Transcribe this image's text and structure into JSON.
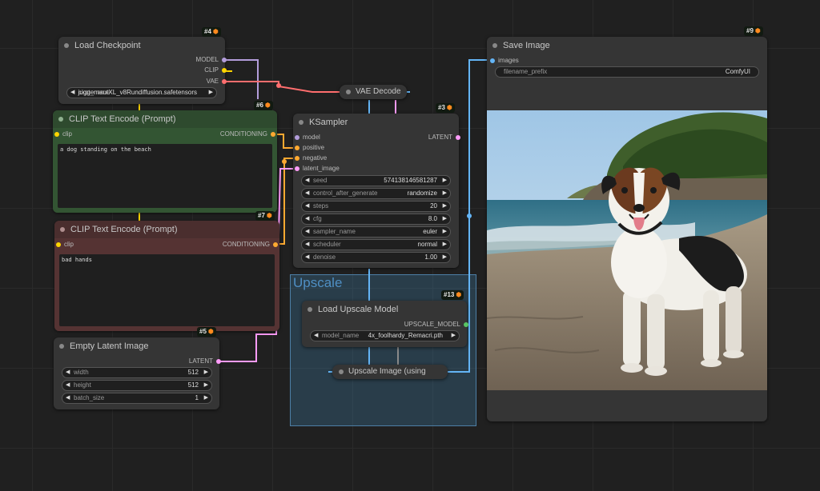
{
  "colors": {
    "model": "#b39ddb",
    "clip": "#ffd500",
    "vae": "#ff6e6e",
    "conditioning": "#ffa931",
    "latent": "#ff9cf9",
    "image": "#64b5f6",
    "upscale_model": "#58c464"
  },
  "nodes": {
    "load_checkpoint": {
      "id": "#4",
      "title": "Load Checkpoint",
      "outputs": [
        "MODEL",
        "CLIP",
        "VAE"
      ],
      "ckpt_name_label": "ckpt_name",
      "ckpt_name_value": "juggernautXL_v8Rundiffusion.safetensors"
    },
    "clip_pos": {
      "id": "#6",
      "title": "CLIP Text Encode (Prompt)",
      "input": "clip",
      "output": "CONDITIONING",
      "text": "a dog standing on the beach"
    },
    "clip_neg": {
      "id": "#7",
      "title": "CLIP Text Encode (Prompt)",
      "input": "clip",
      "output": "CONDITIONING",
      "text": "bad hands"
    },
    "empty_latent": {
      "id": "#5",
      "title": "Empty Latent Image",
      "output": "LATENT",
      "widgets": [
        {
          "label": "width",
          "value": "512"
        },
        {
          "label": "height",
          "value": "512"
        },
        {
          "label": "batch_size",
          "value": "1"
        }
      ]
    },
    "vae_decode": {
      "title": "VAE Decode"
    },
    "ksampler": {
      "id": "#3",
      "title": "KSampler",
      "inputs": [
        "model",
        "positive",
        "negative",
        "latent_image"
      ],
      "output": "LATENT",
      "widgets": [
        {
          "label": "seed",
          "value": "574138146581287"
        },
        {
          "label": "control_after_generate",
          "value": "randomize"
        },
        {
          "label": "steps",
          "value": "20"
        },
        {
          "label": "cfg",
          "value": "8.0"
        },
        {
          "label": "sampler_name",
          "value": "euler"
        },
        {
          "label": "scheduler",
          "value": "normal"
        },
        {
          "label": "denoise",
          "value": "1.00"
        }
      ]
    },
    "upscale_group": {
      "title": "Upscale"
    },
    "load_upscale": {
      "id": "#13",
      "title": "Load Upscale Model",
      "output": "UPSCALE_MODEL",
      "model_name_label": "model_name",
      "model_name_value": "4x_foolhardy_Remacri.pth"
    },
    "upscale_image": {
      "title": "Upscale Image (using"
    },
    "save_image": {
      "id": "#9",
      "title": "Save Image",
      "input": "images",
      "prefix_label": "filename_prefix",
      "prefix_value": "ComfyUI"
    }
  },
  "icons": {
    "badge_icon": "fox-icon",
    "arrow_left": "◀",
    "arrow_right": "▶"
  }
}
